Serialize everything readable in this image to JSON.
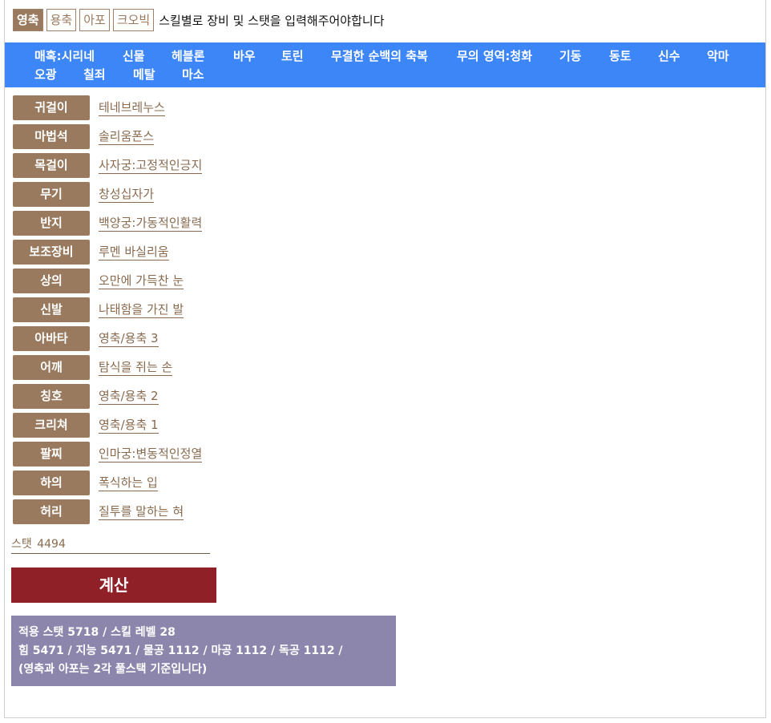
{
  "tabs": [
    {
      "label": "영축",
      "active": true
    },
    {
      "label": "용축",
      "active": false
    },
    {
      "label": "아포",
      "active": false
    },
    {
      "label": "크오빅",
      "active": false
    }
  ],
  "instruction": "스킬별로 장비 및 스탯을 입력해주어야합니다",
  "nav": [
    "매혹:시리네",
    "신물",
    "헤블론",
    "바우",
    "토린",
    "무결한 순백의 축복",
    "무의 영역:청화",
    "기동",
    "동토",
    "신수",
    "악마",
    "오광",
    "칠죄",
    "메탈",
    "마소"
  ],
  "equipment": [
    {
      "slot": "귀걸이",
      "item": "테네브레누스"
    },
    {
      "slot": "마법석",
      "item": "솔리움폰스"
    },
    {
      "slot": "목걸이",
      "item": "사자궁:고정적인긍지"
    },
    {
      "slot": "무기",
      "item": "창성십자가"
    },
    {
      "slot": "반지",
      "item": "백양궁:가동적인활력"
    },
    {
      "slot": "보조장비",
      "item": "루멘 바실리움"
    },
    {
      "slot": "상의",
      "item": "오만에 가득찬 눈"
    },
    {
      "slot": "신발",
      "item": "나태함을 가진 발"
    },
    {
      "slot": "아바타",
      "item": "영축/용축 3"
    },
    {
      "slot": "어깨",
      "item": "탐식을 쥐는 손"
    },
    {
      "slot": "칭호",
      "item": "영축/용축 2"
    },
    {
      "slot": "크리쳐",
      "item": "영축/용축 1"
    },
    {
      "slot": "팔찌",
      "item": "인마궁:변동적인정열"
    },
    {
      "slot": "하의",
      "item": "폭식하는 입"
    },
    {
      "slot": "허리",
      "item": "질투를 말하는 혀"
    }
  ],
  "stat": {
    "label": "스탯",
    "value": "4494"
  },
  "calculate_label": "계산",
  "result": {
    "line1": "적용 스탯 5718 / 스킬 레벨 28",
    "line2": "힘 5471 / 지능 5471 / 물공 1112 / 마공 1112 / 독공 1112 /",
    "line3": "(영축과 아포는 2각 풀스택 기준입니다)"
  },
  "colors": {
    "brown": "#9a7a5e",
    "nav_blue": "#3d86f8",
    "calc_red": "#8f2028",
    "result_purple": "#8c86ad"
  }
}
